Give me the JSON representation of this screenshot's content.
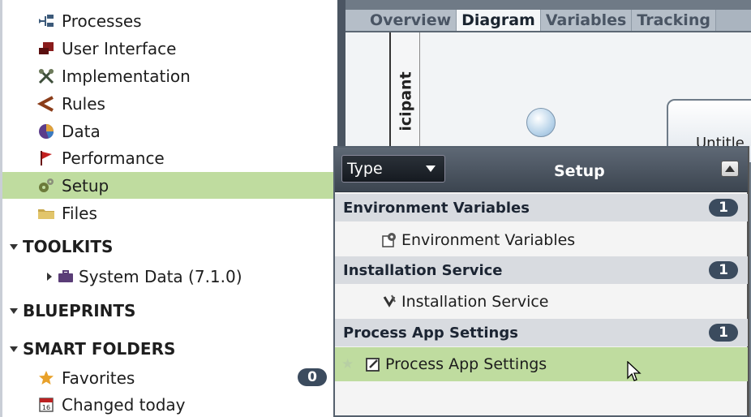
{
  "tree": {
    "items": [
      {
        "label": "Processes",
        "icon": "processes-icon"
      },
      {
        "label": "User Interface",
        "icon": "user-interface-icon"
      },
      {
        "label": "Implementation",
        "icon": "implementation-icon"
      },
      {
        "label": "Rules",
        "icon": "rules-icon"
      },
      {
        "label": "Data",
        "icon": "data-icon"
      },
      {
        "label": "Performance",
        "icon": "performance-flag-icon"
      },
      {
        "label": "Setup",
        "icon": "setup-gears-icon",
        "selected": true
      },
      {
        "label": "Files",
        "icon": "folder-icon"
      }
    ],
    "sections": {
      "toolkits": "TOOLKITS",
      "toolkit_item": "System Data (7.1.0)",
      "blueprints": "BLUEPRINTS",
      "smart_folders": "SMART FOLDERS",
      "favorites": "Favorites",
      "favorites_count": "0",
      "changed_today": "Changed today",
      "calendar_day": "16"
    }
  },
  "editor": {
    "tabs": [
      "Overview",
      "Diagram",
      "Variables",
      "Tracking"
    ],
    "active_tab": "Diagram",
    "lane_label": "icipant",
    "task_label": "Untitle"
  },
  "popup": {
    "type_select": "Type",
    "title": "Setup",
    "groups": [
      {
        "label": "Environment Variables",
        "count": "1",
        "item": "Environment Variables",
        "icon": "environment-variables-icon"
      },
      {
        "label": "Installation Service",
        "count": "1",
        "item": "Installation Service",
        "icon": "installation-service-icon"
      },
      {
        "label": "Process App Settings",
        "count": "1",
        "item": "Process App Settings",
        "icon": "process-app-settings-icon",
        "selected": true
      }
    ]
  },
  "colors": {
    "selection": "#bfdc9f",
    "badge": "#3b4b5e",
    "popup_header": "#4a535e"
  }
}
